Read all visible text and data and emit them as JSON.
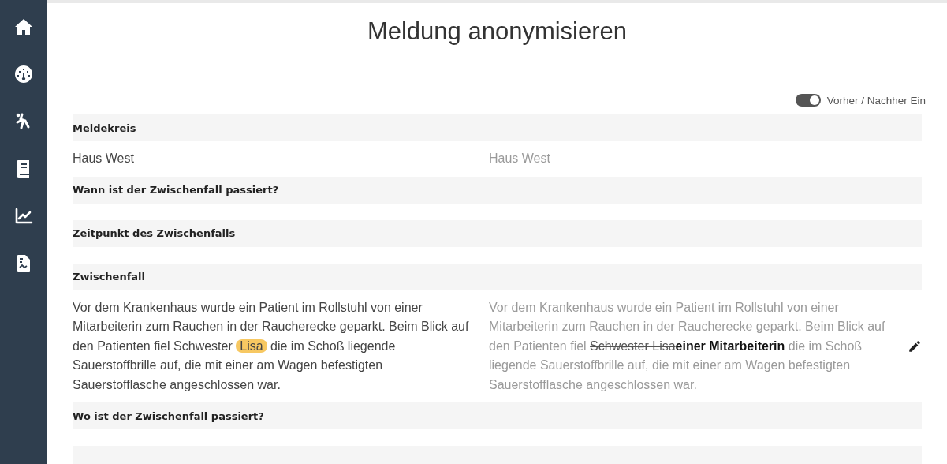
{
  "sidebar": {
    "items": [
      {
        "kind": "home"
      },
      {
        "kind": "gauge"
      },
      {
        "kind": "fall"
      },
      {
        "kind": "book"
      },
      {
        "kind": "chart"
      },
      {
        "kind": "report"
      }
    ]
  },
  "title": "Meldung anonymisieren",
  "toggle": {
    "label": "Vorher / Nachher Ein",
    "on": true
  },
  "sections": [
    {
      "kind": "section",
      "heading": "Meldekreis",
      "before": [
        {
          "kind": "plain",
          "text": "Haus West"
        }
      ],
      "after": [
        {
          "kind": "plain",
          "text": "Haus West"
        }
      ],
      "editable": false
    },
    {
      "kind": "section",
      "heading": "Wann ist der Zwischenfall passiert?"
    },
    {
      "kind": "section",
      "heading": "Zeitpunkt des Zwischenfalls"
    },
    {
      "kind": "section",
      "heading": "Zwischenfall",
      "before": [
        {
          "kind": "plain",
          "text": "Vor dem Krankenhaus wurde ein Patient im Rollstuhl von einer Mitarbeiterin zum Rauchen in der Raucherecke geparkt. Beim Blick auf den Patienten fiel Schwester "
        },
        {
          "kind": "highlight",
          "text": "Lisa"
        },
        {
          "kind": "plain",
          "text": "  die im Schoß liegende Sauerstoffbrille auf, die mit einer am Wagen befestigten Sauerstofflasche angeschlossen war."
        }
      ],
      "after": [
        {
          "kind": "plain",
          "text": "Vor dem Krankenhaus wurde ein Patient im Rollstuhl von einer Mitarbeiterin zum Rauchen in der Raucherecke geparkt. Beim Blick auf den Patienten fiel "
        },
        {
          "kind": "removed",
          "text": "Schwester Lisa"
        },
        {
          "kind": "added",
          "text": "einer Mitarbeiterin"
        },
        {
          "kind": "plain",
          "text": " die im Schoß liegende Sauerstoffbrille auf, die mit einer am Wagen befestigten Sauerstofflasche angeschlossen war."
        }
      ],
      "editable": true
    },
    {
      "kind": "section",
      "heading": "Wo ist der Zwischenfall passiert?"
    },
    {
      "kind": "cut_off"
    }
  ]
}
